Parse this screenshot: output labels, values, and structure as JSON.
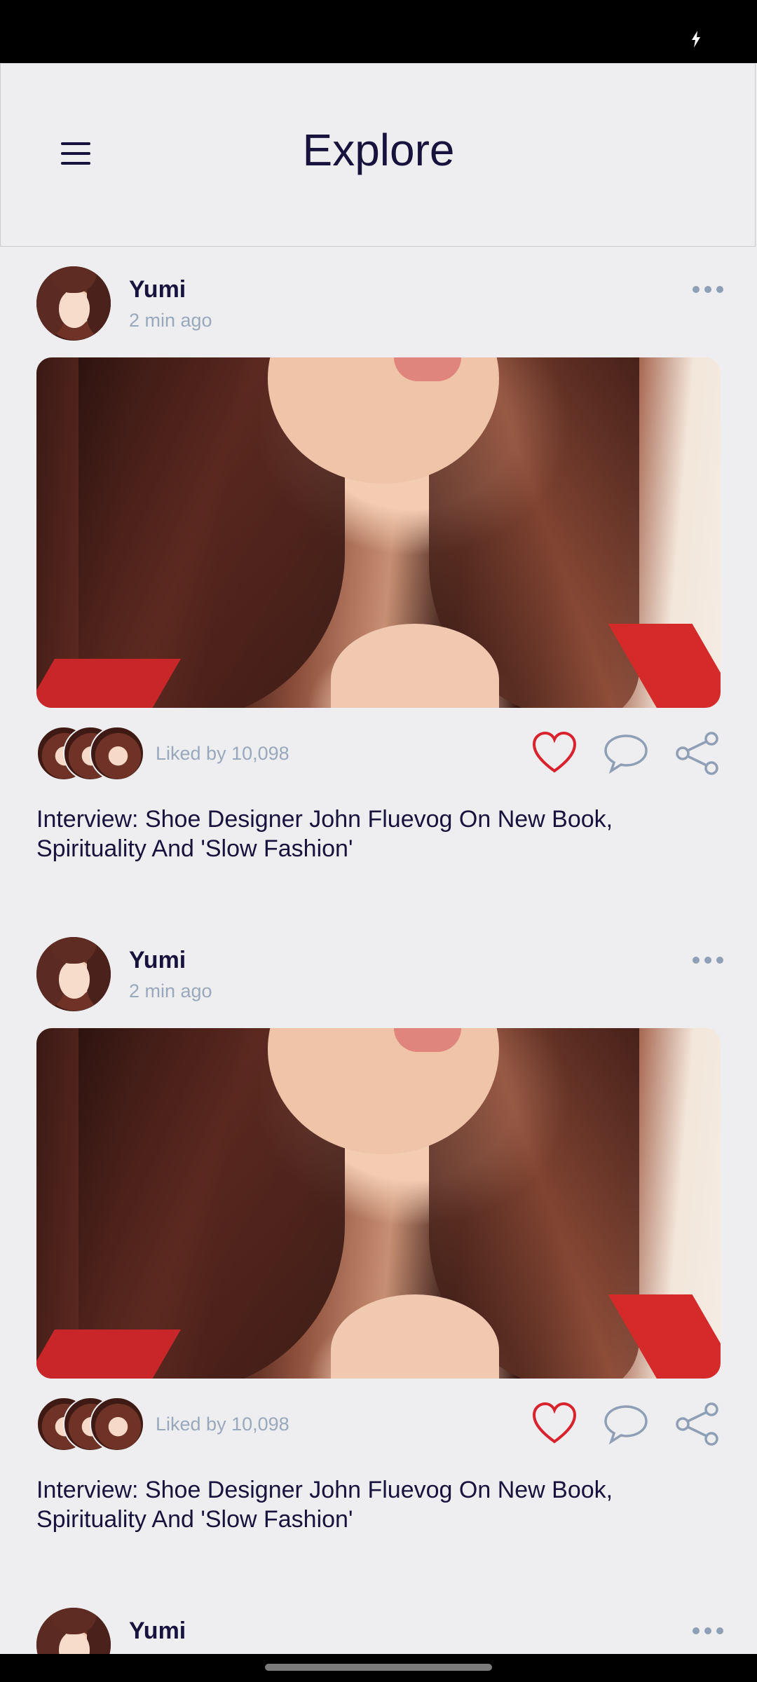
{
  "header": {
    "title": "Explore"
  },
  "posts": [
    {
      "author": "Yumi",
      "time": "2 min ago",
      "liked": "Liked by 10,098",
      "caption": "Interview: Shoe Designer John Fluevog On New Book, Spirituality And 'Slow Fashion'"
    },
    {
      "author": "Yumi",
      "time": "2 min ago",
      "liked": "Liked by 10,098",
      "caption": "Interview: Shoe Designer John Fluevog On New Book, Spirituality And 'Slow Fashion'"
    },
    {
      "author": "Yumi"
    }
  ],
  "colors": {
    "accent_heart": "#d8232f",
    "icon_muted": "#8f9fb6",
    "title": "#17133d",
    "background": "#eeedef"
  },
  "icons": [
    "menu-icon",
    "more-icon",
    "heart-icon",
    "comment-icon",
    "share-icon"
  ]
}
